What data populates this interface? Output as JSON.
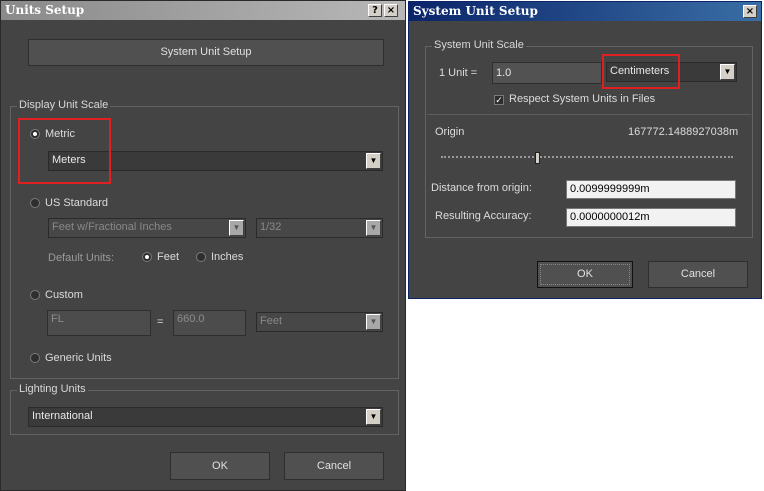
{
  "units_setup": {
    "title": "Units Setup",
    "help_label": "?",
    "close_label": "×",
    "system_unit_setup_button": "System Unit Setup",
    "display_unit_scale": {
      "title": "Display Unit Scale",
      "metric_label": "Metric",
      "metric_selected": true,
      "metric_unit": "Meters",
      "us_standard_label": "US Standard",
      "us_unit": "Feet w/Fractional Inches",
      "us_fraction": "1/32",
      "default_units_label": "Default Units:",
      "feet_label": "Feet",
      "inches_label": "Inches",
      "custom_label": "Custom",
      "custom_name": "FL",
      "equals_label": "=",
      "custom_value": "660.0",
      "custom_unit": "Feet",
      "generic_label": "Generic Units"
    },
    "lighting_units": {
      "title": "Lighting Units",
      "value": "International"
    },
    "ok_label": "OK",
    "cancel_label": "Cancel"
  },
  "system_unit_setup": {
    "title": "System Unit Setup",
    "close_label": "×",
    "scale_group_title": "System Unit Scale",
    "one_unit_label": "1 Unit =",
    "one_unit_value": "1.0",
    "unit": "Centimeters",
    "respect_label": "Respect System Units in Files",
    "respect_checked": true,
    "origin_label": "Origin",
    "origin_value": "167772.1488927038m",
    "distance_label": "Distance from origin:",
    "distance_value": "0.0099999999m",
    "accuracy_label": "Resulting Accuracy:",
    "accuracy_value": "0.0000000012m",
    "ok_label": "OK",
    "cancel_label": "Cancel"
  },
  "colors": {
    "dialog_bg": "#444444",
    "highlight": "#e02020"
  },
  "icons": [
    "dropdown-arrow-icon",
    "check-icon",
    "close-icon",
    "help-icon"
  ]
}
